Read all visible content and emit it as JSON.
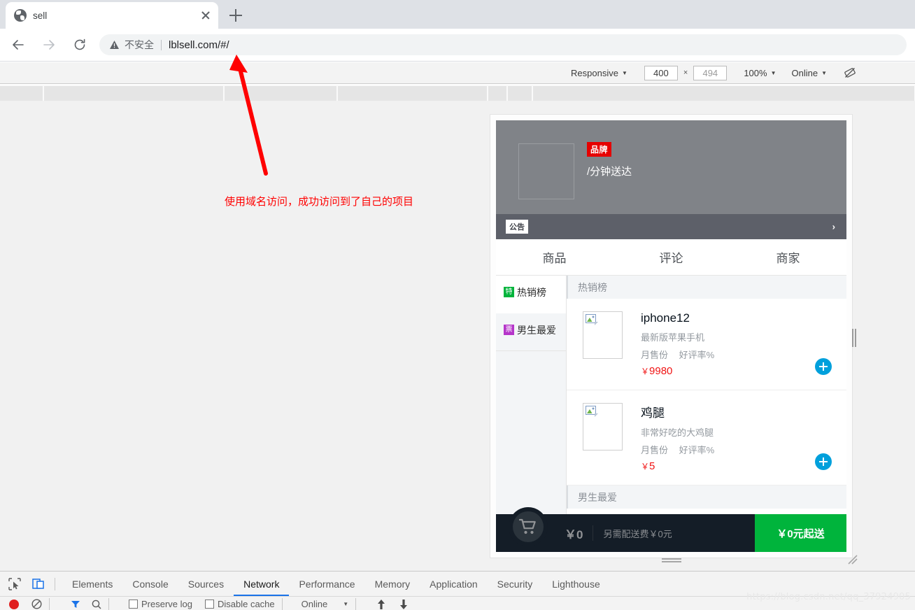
{
  "browser": {
    "tab_title": "sell",
    "new_tab_label": "+",
    "omnibox": {
      "insecure_label": "不安全",
      "url": "lblsell.com/#/"
    }
  },
  "device_toolbar": {
    "device_label": "Responsive",
    "width": "400",
    "height": "494",
    "times": "×",
    "zoom": "100%",
    "throttling": "Online"
  },
  "annotation": {
    "text": "使用域名访问，成功访问到了自己的项目",
    "color": "#ff0000"
  },
  "shop": {
    "brand_badge": "品牌",
    "delivery_text": "/分钟送达",
    "bulletin_tag": "公告",
    "bulletin_arrow": "›",
    "tabs": [
      {
        "label": "商品"
      },
      {
        "label": "评论"
      },
      {
        "label": "商家"
      }
    ],
    "menu": [
      {
        "badge": "特",
        "badge_color": "#00b43c",
        "label": "热销榜",
        "active": true
      },
      {
        "badge": "票",
        "badge_color": "#b535c9",
        "label": "男生最爱",
        "active": false
      }
    ],
    "sections": [
      {
        "title": "热销榜",
        "foods": [
          {
            "name": "iphone12",
            "desc": "最新版苹果手机",
            "sell_count": "月售份",
            "rating": "好评率%",
            "price_symbol": "￥",
            "price": "9980"
          },
          {
            "name": "鸡腿",
            "desc": "非常好吃的大鸡腿",
            "sell_count": "月售份",
            "rating": "好评率%",
            "price_symbol": "￥",
            "price": "5"
          }
        ]
      },
      {
        "title": "男生最爱",
        "foods": []
      }
    ],
    "cart": {
      "total_price": "￥0",
      "delivery_fee": "另需配送费￥0元",
      "pay_label": "￥0元起送"
    }
  },
  "devtools": {
    "tabs": [
      {
        "label": "Elements",
        "active": false
      },
      {
        "label": "Console",
        "active": false
      },
      {
        "label": "Sources",
        "active": false
      },
      {
        "label": "Network",
        "active": true
      },
      {
        "label": "Performance",
        "active": false
      },
      {
        "label": "Memory",
        "active": false
      },
      {
        "label": "Application",
        "active": false
      },
      {
        "label": "Security",
        "active": false
      },
      {
        "label": "Lighthouse",
        "active": false
      }
    ],
    "network_bar": {
      "preserve_log": "Preserve log",
      "disable_cache": "Disable cache",
      "throttle": "Online"
    }
  },
  "watermark": "https://blog.csdn.net/qq_37924905"
}
